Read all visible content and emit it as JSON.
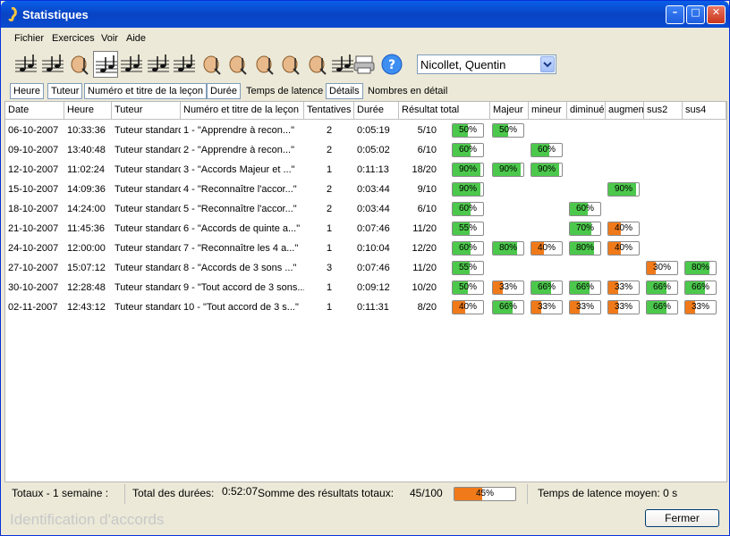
{
  "window": {
    "title": "Statistiques"
  },
  "menu": [
    "Fichier",
    "Exercices",
    "Voir",
    "Aide"
  ],
  "toolbar": {
    "tools": [
      "notes-icon",
      "notes-flat-icon",
      "tutor-icon",
      "note-single-icon",
      "note-staff-icon",
      "note-ny-icon",
      "scale-icon",
      "hand-icon",
      "hand-flag-icon",
      "hand-pen-icon",
      "ear-note-icon",
      "ear-notes-icon",
      "chord-icon",
      "printer-icon",
      "help-icon"
    ],
    "active_tool_index": 3,
    "student_selected": "Nicollet, Quentin"
  },
  "tabs": [
    "Heure",
    "Tuteur",
    "Numéro et titre de la leçon",
    "Durée",
    "Temps de latence",
    "Détails",
    "Nombres en détail"
  ],
  "columns": [
    "Date",
    "Heure",
    "Tuteur",
    "Numéro et titre de la leçon",
    "Tentatives",
    "Durée",
    "Résultat total",
    "Majeur",
    "mineur",
    "diminué",
    "augmenté",
    "sus2",
    "sus4"
  ],
  "rows": [
    {
      "date": "06-10-2007",
      "heure": "10:33:36",
      "tuteur": "Tuteur standard",
      "lecon": "1 - \"Apprendre à recon...\"",
      "tentatives": "2",
      "duree": "0:05:19",
      "resultat": "5/10",
      "total": 50,
      "cats": [
        50,
        null,
        null,
        null,
        null,
        null
      ]
    },
    {
      "date": "09-10-2007",
      "heure": "13:40:48",
      "tuteur": "Tuteur standard",
      "lecon": "2 - \"Apprendre à recon...\"",
      "tentatives": "2",
      "duree": "0:05:02",
      "resultat": "6/10",
      "total": 60,
      "cats": [
        null,
        60,
        null,
        null,
        null,
        null
      ]
    },
    {
      "date": "12-10-2007",
      "heure": "11:02:24",
      "tuteur": "Tuteur standard",
      "lecon": "3 - \"Accords Majeur et ...\"",
      "tentatives": "1",
      "duree": "0:11:13",
      "resultat": "18/20",
      "total": 90,
      "cats": [
        90,
        90,
        null,
        null,
        null,
        null
      ]
    },
    {
      "date": "15-10-2007",
      "heure": "14:09:36",
      "tuteur": "Tuteur standard",
      "lecon": "4 - \"Reconnaître l'accor...\"",
      "tentatives": "2",
      "duree": "0:03:44",
      "resultat": "9/10",
      "total": 90,
      "cats": [
        null,
        null,
        null,
        90,
        null,
        null
      ]
    },
    {
      "date": "18-10-2007",
      "heure": "14:24:00",
      "tuteur": "Tuteur standard",
      "lecon": "5 - \"Reconnaître l'accor...\"",
      "tentatives": "2",
      "duree": "0:03:44",
      "resultat": "6/10",
      "total": 60,
      "cats": [
        null,
        null,
        60,
        null,
        null,
        null
      ]
    },
    {
      "date": "21-10-2007",
      "heure": "11:45:36",
      "tuteur": "Tuteur standard",
      "lecon": "6 - \"Accords de quinte a...\"",
      "tentatives": "1",
      "duree": "0:07:46",
      "resultat": "11/20",
      "total": 55,
      "cats": [
        null,
        null,
        70,
        40,
        null,
        null
      ]
    },
    {
      "date": "24-10-2007",
      "heure": "12:00:00",
      "tuteur": "Tuteur standard",
      "lecon": "7 - \"Reconnaître les 4 a...\"",
      "tentatives": "1",
      "duree": "0:10:04",
      "resultat": "12/20",
      "total": 60,
      "cats": [
        80,
        40,
        80,
        40,
        null,
        null
      ]
    },
    {
      "date": "27-10-2007",
      "heure": "15:07:12",
      "tuteur": "Tuteur standard",
      "lecon": "8 - \"Accords de 3 sons ...\"",
      "tentatives": "3",
      "duree": "0:07:46",
      "resultat": "11/20",
      "total": 55,
      "cats": [
        null,
        null,
        null,
        null,
        30,
        80
      ]
    },
    {
      "date": "30-10-2007",
      "heure": "12:28:48",
      "tuteur": "Tuteur standard",
      "lecon": "9 - \"Tout accord de 3 sons...\"",
      "tentatives": "1",
      "duree": "0:09:12",
      "resultat": "10/20",
      "total": 50,
      "cats": [
        33,
        66,
        66,
        33,
        66,
        66
      ]
    },
    {
      "date": "02-11-2007",
      "heure": "12:43:12",
      "tuteur": "Tuteur standard",
      "lecon": "10 - \"Tout accord de 3 s...\"",
      "tentatives": "1",
      "duree": "0:11:31",
      "resultat": "8/20",
      "total": 40,
      "cats": [
        66,
        33,
        33,
        33,
        66,
        33
      ]
    }
  ],
  "status": {
    "totaux": "Totaux - 1 semaine :",
    "total_durees_label": "Total des durées:",
    "total_durees_value": "0:52:07",
    "somme_label": "Somme des résultats totaux:",
    "somme_value": "45/100",
    "somme_percent": 45,
    "latence": "Temps de latence moyen: 0 s"
  },
  "footer": {
    "module_title": "Identification d'accords",
    "close_label": "Fermer"
  },
  "colors": {
    "good": "#4cc84c",
    "bad": "#f07a1a",
    "titlebar": "#0a4bd0"
  }
}
